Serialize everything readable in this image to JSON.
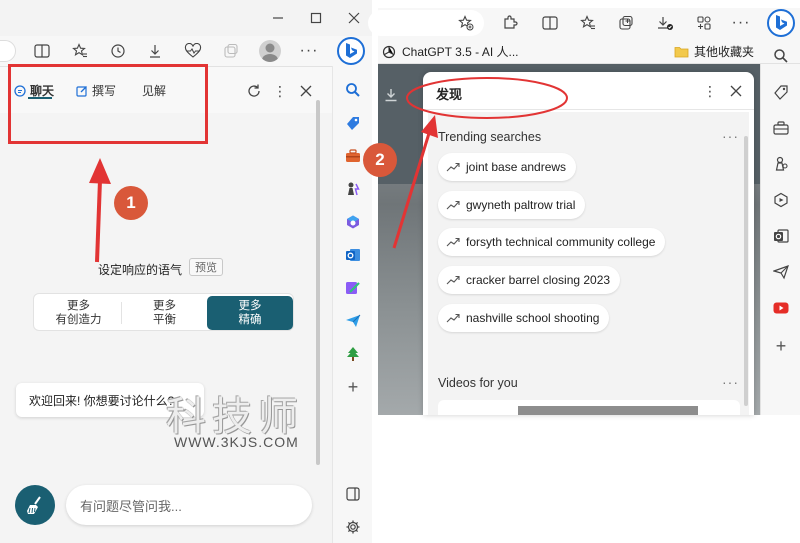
{
  "left": {
    "tabs": [
      {
        "label": "聊天",
        "icon": "chat-icon"
      },
      {
        "label": "撰写",
        "icon": "compose-icon"
      },
      {
        "label": "见解",
        "icon": ""
      }
    ],
    "tone_label": "设定响应的语气",
    "preview_badge": "预览",
    "tones": [
      {
        "line1": "更多",
        "line2": "有创造力"
      },
      {
        "line1": "更多",
        "line2": "平衡"
      },
      {
        "line1": "更多",
        "line2": "精确"
      }
    ],
    "active_tone_index": 2,
    "greeting": "欢迎回来! 你想要讨论什么?",
    "input_placeholder": "有问题尽管问我..."
  },
  "right": {
    "favorites": [
      {
        "label": "ChatGPT 3.5 - AI 人...",
        "icon": "openai-icon"
      },
      {
        "label": "其他收藏夹",
        "icon": "folder-icon"
      }
    ],
    "panel_title": "发现",
    "trending_title": "Trending searches",
    "trending": [
      "joint base andrews",
      "gwyneth paltrow trial",
      "forsyth technical community college",
      "cracker barrel closing 2023",
      "nashville school shooting"
    ],
    "videos_title": "Videos for you"
  },
  "annotations": {
    "step1": "1",
    "step2": "2"
  },
  "watermark": {
    "title": "科技师",
    "url": "WWW.3KJS.COM"
  },
  "colors": {
    "accent": "#1a5f72",
    "annotation_red": "#e23434",
    "badge": "#d9583a"
  }
}
